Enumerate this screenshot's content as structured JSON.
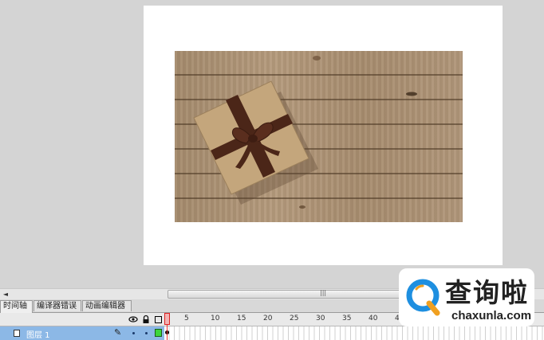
{
  "stage": {
    "photo_alt": "gift box on wooden boards"
  },
  "scrollbar": {
    "left_arrow": "◄",
    "thumb_grip": "|||"
  },
  "panel_tabs": [
    {
      "label": "时间轴",
      "active": true
    },
    {
      "label": "编译器错误",
      "active": false
    },
    {
      "label": "动画编辑器",
      "active": false
    }
  ],
  "timeline": {
    "header_icons": [
      "eye-icon",
      "lock-icon",
      "outline-icon"
    ],
    "playhead_frame": "1",
    "frame_numbers": [
      "5",
      "10",
      "15",
      "20",
      "25",
      "30",
      "35",
      "40",
      "45"
    ],
    "layers": [
      {
        "name": "图层 1",
        "color": "#3cd63c"
      }
    ]
  },
  "watermark": {
    "brand": "查询啦",
    "url": "chaxunla.com",
    "colors": {
      "ring": "#1e8fe0",
      "accent": "#f0a020"
    }
  }
}
